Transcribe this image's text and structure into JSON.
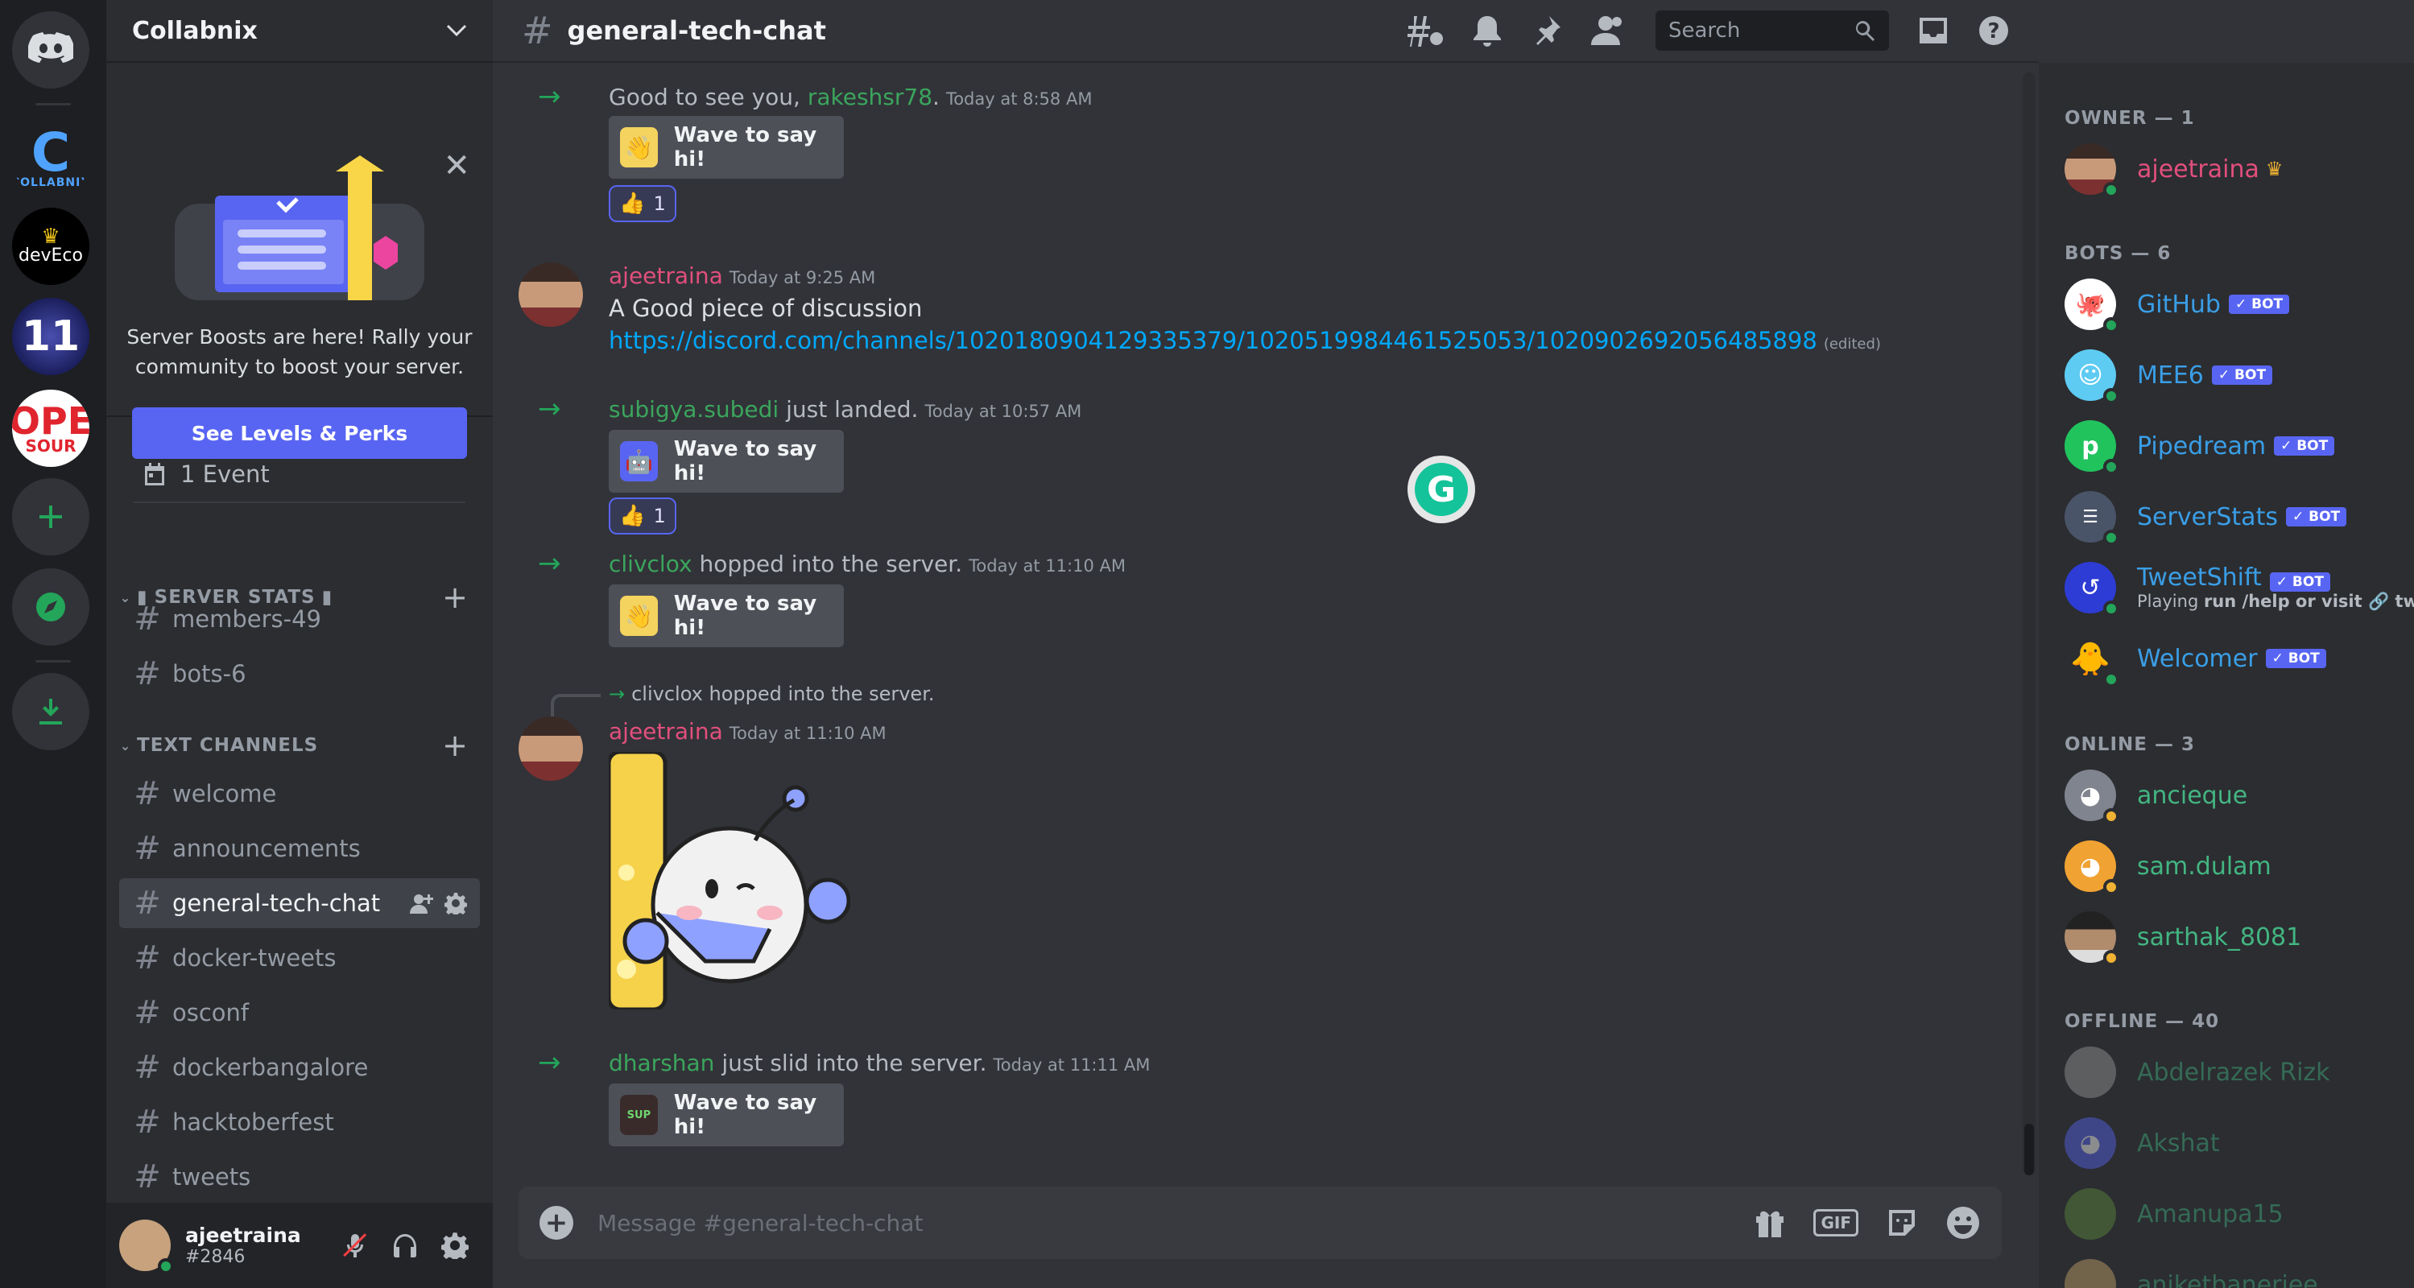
{
  "rail": {
    "collabnix_label": "COLLABNIX",
    "deveco_label": "devEco",
    "eleven_label": "11",
    "open_label": "OPE",
    "open_sub": "SOUR"
  },
  "guild": {
    "name": "Collabnix"
  },
  "boost": {
    "text": "Server Boosts are here! Rally your community to boost your server.",
    "button": "See Levels & Perks"
  },
  "events": {
    "label": "1 Event"
  },
  "categories": {
    "server_stats": "SERVER STATS",
    "text_channels": "TEXT CHANNELS"
  },
  "channels": {
    "stats": [
      "members-49",
      "bots-6"
    ],
    "text": [
      "welcome",
      "announcements",
      "general-tech-chat",
      "docker-tweets",
      "osconf",
      "dockerbangalore",
      "hacktoberfest",
      "tweets"
    ]
  },
  "user": {
    "name": "ajeetraina",
    "discriminator": "#2846"
  },
  "header": {
    "channel": "general-tech-chat",
    "search_placeholder": "Search"
  },
  "messages": {
    "m1": {
      "prefix": "Good to see you, ",
      "user": "rakeshsr78",
      "suffix": ".",
      "time": "Today at 8:58 AM",
      "wave": "Wave to say hi!",
      "reaction_count": "1"
    },
    "m2": {
      "user": "ajeetraina",
      "time": "Today at 9:25 AM",
      "text": "A Good piece of discussion",
      "link": "https://discord.com/channels/1020180904129335379/1020519984461525053/1020902692056485898",
      "edited": "(edited)"
    },
    "m3": {
      "user": "subigya.subedi",
      "suffix": " just landed.",
      "time": "Today at 10:57 AM",
      "wave": "Wave to say hi!",
      "reaction_count": "1"
    },
    "m4": {
      "user": "clivclox",
      "suffix": " hopped into the server.",
      "time": "Today at 11:10 AM",
      "wave": "Wave to say hi!"
    },
    "m5": {
      "reply": "clivclox hopped into the server.",
      "user": "ajeetraina",
      "time": "Today at 11:10 AM"
    },
    "m6": {
      "user": "dharshan",
      "suffix": " just slid into the server.",
      "time": "Today at 11:11 AM",
      "wave": "Wave to say hi!",
      "sticker_text": "SUP"
    }
  },
  "composer": {
    "placeholder": "Message #general-tech-chat",
    "gif_label": "GIF"
  },
  "members": {
    "owner_heading": "OWNER — 1",
    "owner": "ajeetraina",
    "bots_heading": "BOTS — 6",
    "bot_tag": "✓ BOT",
    "bots": [
      "GitHub",
      "MEE6",
      "Pipedream",
      "ServerStats",
      "TweetShift",
      "Welcomer"
    ],
    "tweetshift_activity_prefix": "Playing ",
    "tweetshift_activity_bold": "run /help or visit 🔗 tw...",
    "online_heading": "ONLINE — 3",
    "online": [
      "ancieque",
      "sam.dulam",
      "sarthak_8081"
    ],
    "offline_heading": "OFFLINE — 40",
    "offline": [
      "Abdelrazek Rizk",
      "Akshat",
      "Amanupa15",
      "aniketbanerjee"
    ]
  },
  "colors": {
    "accent": "#5865f2",
    "online": "#23a55a",
    "owner_name": "#e24f7c",
    "bot_name": "#3a9ee6",
    "link": "#00a8fc"
  }
}
